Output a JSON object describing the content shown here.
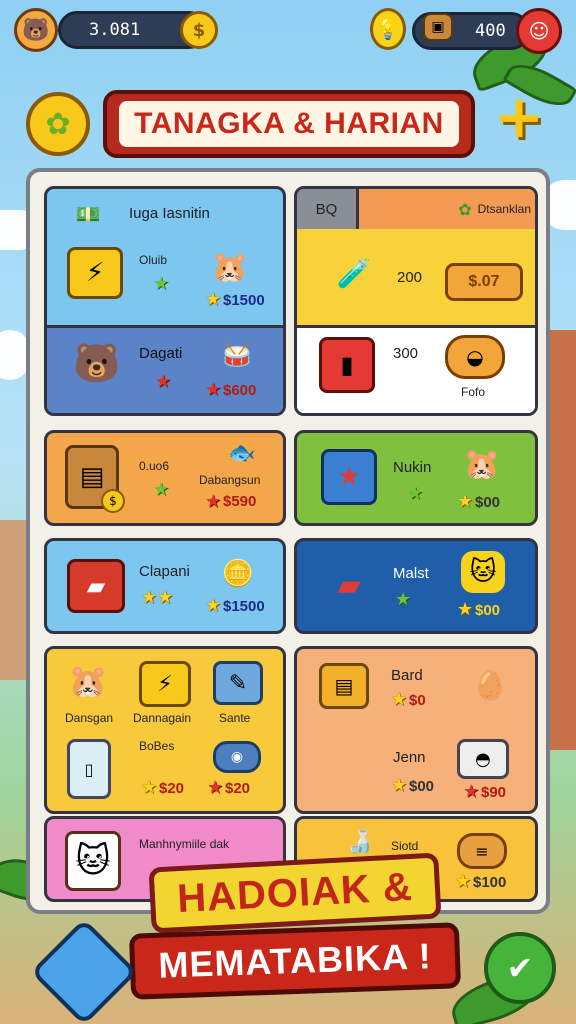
{
  "topbar": {
    "left_currency": "3.081",
    "right_currency": "400"
  },
  "header": {
    "title": "TANAGKA & HARIAN"
  },
  "panel_tabs": {
    "tab_small": "BQ",
    "tab_main": "Dtsanklan"
  },
  "cards": [
    {
      "label": "Iuga Iasnitin",
      "item_label": "Oluib",
      "price": "$1500"
    },
    {
      "label": "Dagati",
      "price": "$600"
    },
    {
      "label": "0.uo6",
      "item_label": "Dabangsun",
      "price": "$590"
    },
    {
      "label": "Clapani",
      "price": "$1500"
    },
    {
      "label": "Dansgan",
      "item_label2": "Dannagain",
      "item_label3": "Sante",
      "label_b": "BoBes",
      "price_b": "$20",
      "price_c": "$20"
    },
    {
      "label": "Manhnymiile dak"
    }
  ],
  "right_cards": [
    {
      "count": "200",
      "button": "$.07"
    },
    {
      "count": "300",
      "item_label": "Fofo"
    },
    {
      "label": "Nukin",
      "price": "$00"
    },
    {
      "label": "Malst",
      "price": "$00"
    },
    {
      "label": "Bard",
      "price": "$0",
      "label_b": "Jenn",
      "price_b": "$00",
      "price_c": "$90"
    },
    {
      "label": "Siotd",
      "price": "$100"
    }
  ],
  "footer": {
    "line1": "HADOIAK &",
    "line2": "MEMATABIKA !"
  },
  "colors": {
    "title_red": "#c8271a",
    "price_blue": "#1f2b86",
    "banner_yellow": "#f2d530"
  }
}
